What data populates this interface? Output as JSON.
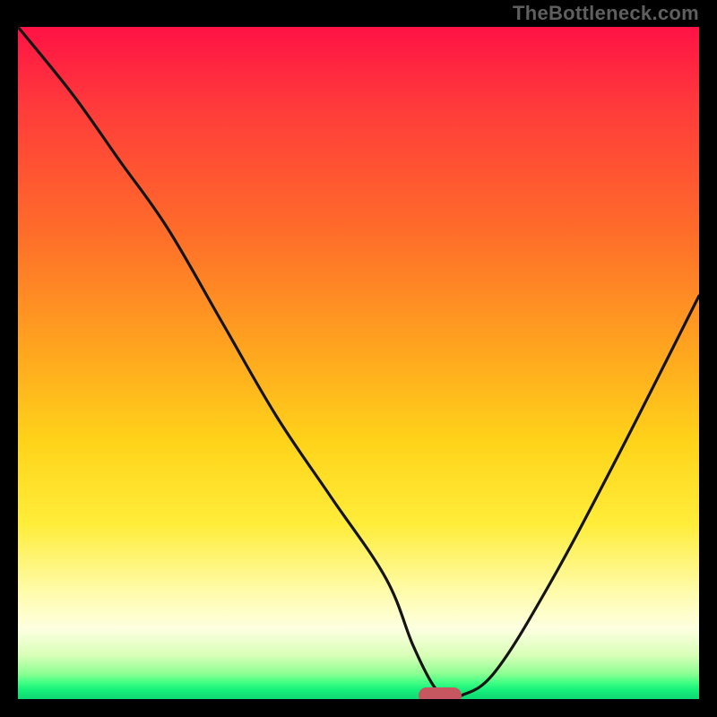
{
  "watermark": "TheBottleneck.com",
  "colors": {
    "frame_bg": "#000000",
    "gradient_top": "#ff1245",
    "gradient_mid": "#ffd41a",
    "gradient_bottom": "#0fd873",
    "curve_stroke": "#141414",
    "marker_fill": "#c6565f"
  },
  "chart_data": {
    "type": "line",
    "title": "",
    "xlabel": "",
    "ylabel": "",
    "xlim": [
      0,
      100
    ],
    "ylim": [
      0,
      100
    ],
    "grid": false,
    "legend": false,
    "annotations": [
      {
        "kind": "pill-marker",
        "x": 62,
        "y": 0.5
      }
    ],
    "series": [
      {
        "name": "bottleneck-curve",
        "x": [
          0,
          8,
          15,
          22,
          30,
          38,
          46,
          54,
          58,
          61,
          63,
          65,
          70,
          78,
          88,
          100
        ],
        "values": [
          100,
          90,
          80,
          70,
          56,
          42,
          30,
          18,
          8,
          2,
          0.5,
          0.5,
          4,
          17,
          36,
          60
        ]
      }
    ]
  }
}
